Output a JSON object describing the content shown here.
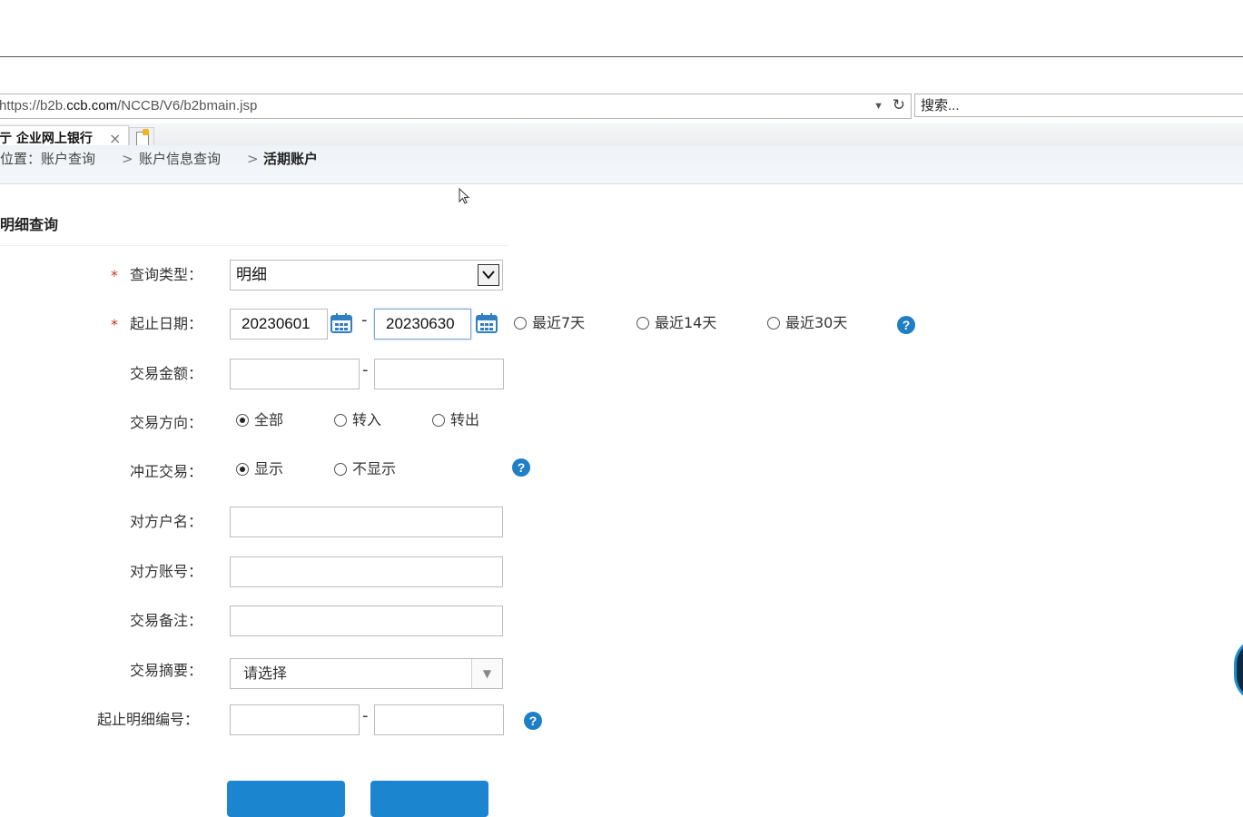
{
  "browser": {
    "url_prefix": "https://b2b.",
    "url_host": "ccb.com",
    "url_path": "/NCCB/V6/b2bmain.jsp",
    "search_placeholder": "搜索...",
    "tab_title": "亍 企业网上银行",
    "tab_close": "×"
  },
  "breadcrumb": {
    "items": [
      "位置：账户查询",
      "账户信息查询",
      "活期账户"
    ],
    "separator": ">"
  },
  "section": {
    "title": "明细查询"
  },
  "form": {
    "required_mark": "*",
    "query_type": {
      "label": "查询类型：",
      "value": "明细"
    },
    "date_range": {
      "label": "起止日期：",
      "start": "20230601",
      "end": "20230630",
      "quick_options": [
        "最近7天",
        "最近14天",
        "最近30天"
      ]
    },
    "amount": {
      "label": "交易金额：",
      "min": "",
      "max": ""
    },
    "direction": {
      "label": "交易方向：",
      "options": [
        "全部",
        "转入",
        "转出"
      ],
      "selected": "全部"
    },
    "reversal": {
      "label": "冲正交易：",
      "options": [
        "显示",
        "不显示"
      ],
      "selected": "显示"
    },
    "counterparty_name": {
      "label": "对方户名：",
      "value": ""
    },
    "counterparty_account": {
      "label": "对方账号：",
      "value": ""
    },
    "remark": {
      "label": "交易备注：",
      "value": ""
    },
    "summary": {
      "label": "交易摘要：",
      "placeholder": "请选择"
    },
    "detail_no": {
      "label": "起止明细编号：",
      "start": "",
      "end": ""
    },
    "range_dash": "-"
  },
  "help_glyph": "?",
  "icons": [
    "calendar-icon",
    "help-icon",
    "refresh-icon",
    "dropdown-icon"
  ],
  "colors": {
    "accent": "#1b86cf",
    "required": "#c0392b",
    "help": "#1e7fc8"
  }
}
